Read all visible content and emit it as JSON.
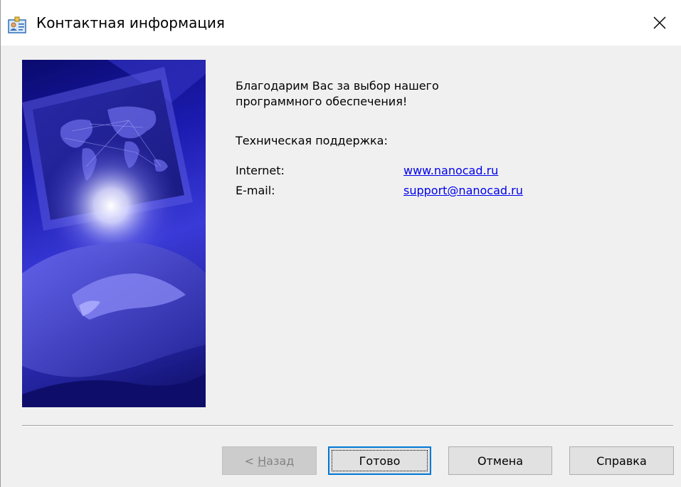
{
  "window": {
    "title": "Контактная информация"
  },
  "content": {
    "thanks": "Благодарим Вас за выбор нашего программного обеспечения!",
    "support_heading": "Техническая поддержка:",
    "contacts": [
      {
        "label": "Internet:",
        "value": "www.nanocad.ru"
      },
      {
        "label": "E-mail:",
        "value": "support@nanocad.ru"
      }
    ]
  },
  "buttons": {
    "back_prefix": "< ",
    "back_accel": "Н",
    "back_rest": "азад",
    "finish": "Готово",
    "cancel": "Отмена",
    "help": "Справка"
  },
  "colors": {
    "link": "#0000ee",
    "default_button_border": "#0078d7",
    "banner": "#2a2ac8"
  }
}
